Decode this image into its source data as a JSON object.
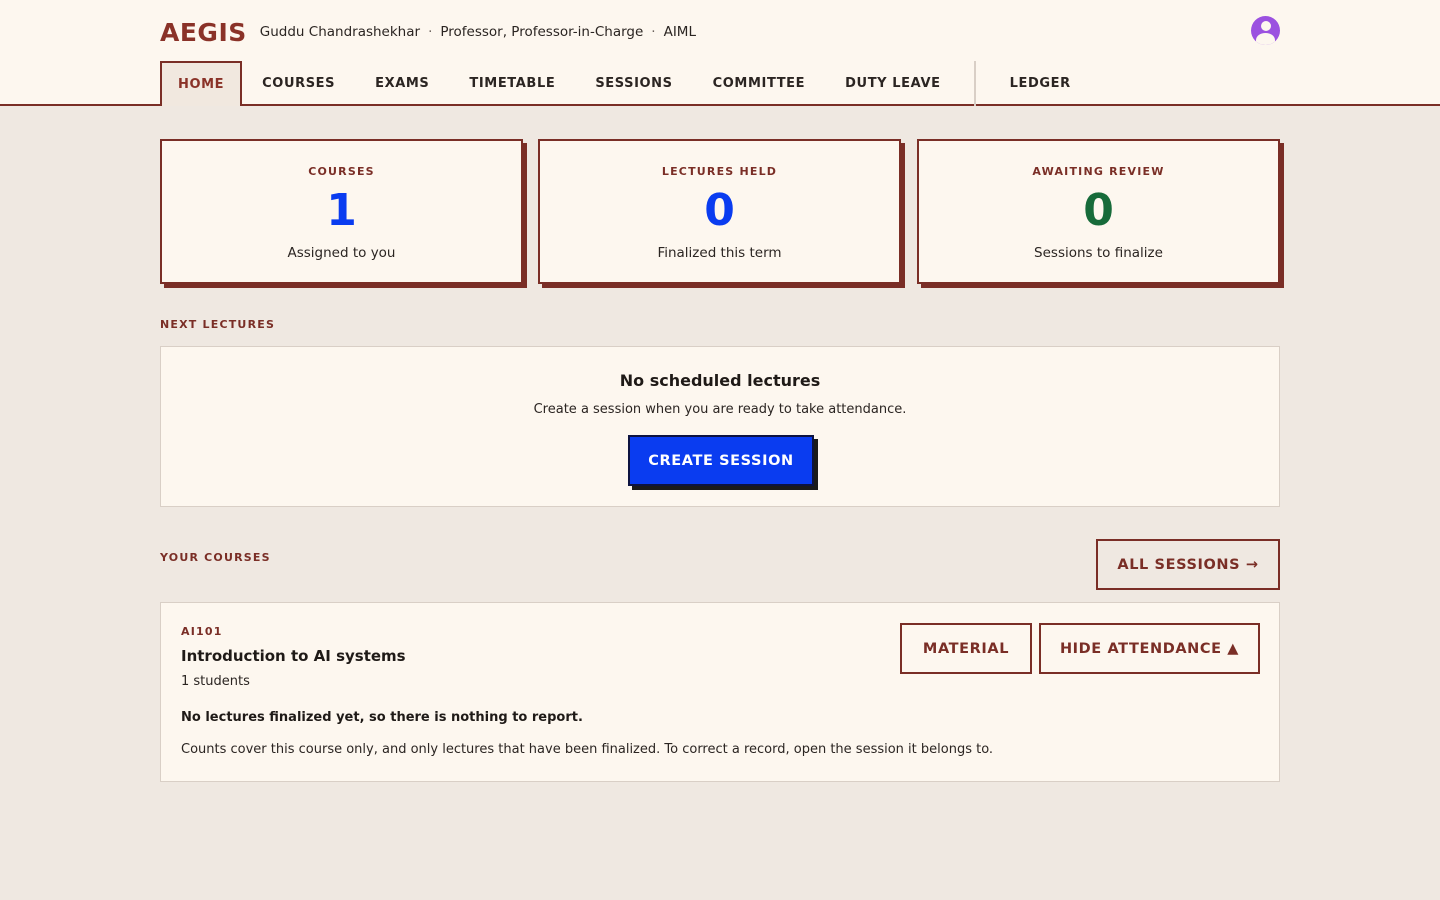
{
  "header": {
    "brand": "AEGIS",
    "user_name": "Guddu Chandrashekhar",
    "separator": "·",
    "user_role": "Professor, Professor-in-Charge",
    "department": "AIML",
    "avatar_icon": "user-avatar-icon"
  },
  "nav": {
    "items": [
      "HOME",
      "COURSES",
      "EXAMS",
      "TIMETABLE",
      "SESSIONS",
      "COMMITTEE",
      "DUTY LEAVE"
    ],
    "extra": "LEDGER",
    "active": "HOME"
  },
  "stats": [
    {
      "label": "COURSES",
      "value": "1",
      "sub": "Assigned to you",
      "color": "#0a3cf0"
    },
    {
      "label": "LECTURES HELD",
      "value": "0",
      "sub": "Finalized this term",
      "color": "#0a3cf0"
    },
    {
      "label": "AWAITING REVIEW",
      "value": "0",
      "sub": "Sessions to finalize",
      "color": "#176b3a"
    }
  ],
  "next_lectures": {
    "section_label": "NEXT LECTURES",
    "empty_title": "No scheduled lectures",
    "empty_subtitle": "Create a session when you are ready to take attendance.",
    "create_button": "CREATE SESSION"
  },
  "your_courses": {
    "section_label": "YOUR COURSES",
    "all_sessions_button": "ALL SESSIONS →",
    "course": {
      "code": "AI101",
      "title": "Introduction to AI systems",
      "students": "1 students",
      "material_button": "MATERIAL",
      "attendance_button": "HIDE ATTENDANCE ▲",
      "report_status": "No lectures finalized yet, so there is nothing to report.",
      "note": "Counts cover this course only, and only lectures that have been finalized. To correct a record, open the session it belongs to."
    }
  },
  "colors": {
    "accent": "#7a2e26",
    "brand": "#8a3228",
    "primary": "#0a3cf0",
    "success": "#176b3a",
    "background": "#efe8e1",
    "surface": "#fdf7ef"
  }
}
